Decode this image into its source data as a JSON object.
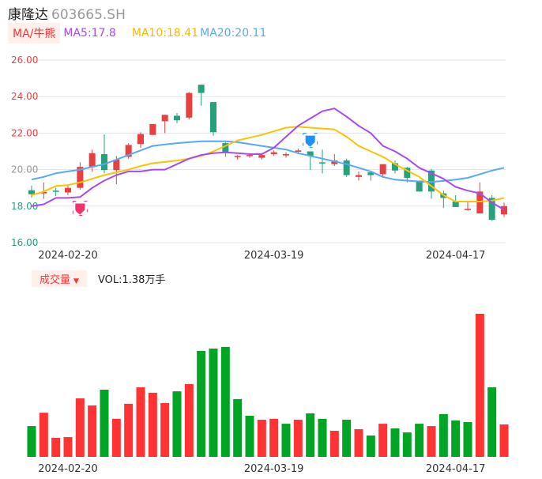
{
  "header": {
    "name": "康隆达",
    "code": "603665.SH"
  },
  "legend": {
    "tag": "MA/牛熊",
    "ma5": "MA5:17.8",
    "ma10": "MA10:18.41",
    "ma20": "MA20:20.11"
  },
  "volume_legend": {
    "tag": "成交量",
    "arrow": "▼",
    "value": "VOL:1.38万手"
  },
  "colors": {
    "up": "#e84040",
    "down": "#26a17d",
    "vol_up": "#ff3333",
    "vol_down": "#00a526",
    "ma5": "#a64bf4",
    "ma10": "#fbc400",
    "ma20": "#5aa7f5",
    "grid": "#e3e3ec",
    "axis_up": "#f23d3d",
    "axis_mid": "#999999",
    "axis_down": "#26a17d"
  },
  "chart_data": [
    {
      "type": "candlestick",
      "title": "",
      "ylim": [
        16,
        26
      ],
      "y_ticks": [
        "26.00",
        "24.00",
        "22.00",
        "20.00",
        "18.00",
        "16.00"
      ],
      "x_ticks": [
        {
          "index": 3,
          "label": "2024-02-20"
        },
        {
          "index": 20,
          "label": "2024-03-19"
        },
        {
          "index": 35,
          "label": "2024-04-17"
        }
      ],
      "grid": true,
      "ohlc": [
        [
          18.87,
          19.12,
          18.47,
          18.65
        ],
        [
          18.7,
          19.3,
          18.4,
          18.78
        ],
        [
          18.85,
          19.0,
          18.55,
          18.8
        ],
        [
          18.75,
          19.2,
          18.6,
          19.0
        ],
        [
          19.0,
          20.4,
          18.9,
          20.15
        ],
        [
          20.15,
          21.1,
          19.9,
          20.9
        ],
        [
          20.85,
          21.93,
          19.8,
          19.98
        ],
        [
          19.98,
          20.75,
          19.2,
          20.55
        ],
        [
          20.7,
          21.45,
          20.6,
          21.35
        ],
        [
          21.4,
          22.05,
          21.2,
          21.95
        ],
        [
          21.9,
          22.5,
          21.9,
          22.5
        ],
        [
          22.65,
          23.0,
          22.0,
          23.0
        ],
        [
          22.95,
          23.1,
          22.55,
          22.7
        ],
        [
          22.85,
          24.25,
          22.75,
          24.2
        ],
        [
          24.65,
          24.65,
          23.5,
          24.2
        ],
        [
          23.7,
          23.7,
          21.85,
          22.05
        ],
        [
          21.45,
          21.5,
          20.7,
          20.95
        ],
        [
          20.7,
          20.8,
          20.55,
          20.75
        ],
        [
          20.75,
          20.9,
          20.65,
          20.8
        ],
        [
          20.65,
          20.9,
          20.55,
          20.8
        ],
        [
          20.85,
          21.05,
          20.75,
          20.95
        ],
        [
          20.78,
          20.95,
          20.65,
          20.85
        ],
        [
          20.98,
          21.15,
          20.85,
          21.05
        ],
        [
          21.0,
          21.0,
          19.98,
          20.75
        ],
        [
          20.4,
          21.1,
          19.8,
          20.35
        ],
        [
          20.3,
          20.85,
          20.2,
          20.5
        ],
        [
          20.5,
          20.6,
          19.6,
          19.7
        ],
        [
          19.6,
          19.9,
          19.4,
          19.7
        ],
        [
          19.85,
          19.9,
          19.4,
          19.7
        ],
        [
          19.75,
          20.3,
          19.55,
          20.3
        ],
        [
          20.35,
          20.5,
          19.8,
          19.95
        ],
        [
          20.1,
          20.15,
          19.3,
          19.55
        ],
        [
          19.4,
          19.4,
          18.8,
          18.8
        ],
        [
          19.95,
          20.05,
          18.4,
          18.8
        ],
        [
          18.7,
          18.85,
          17.9,
          18.45
        ],
        [
          18.25,
          18.6,
          17.95,
          17.95
        ],
        [
          17.8,
          18.2,
          17.75,
          17.85
        ],
        [
          17.6,
          19.3,
          17.6,
          18.8
        ],
        [
          18.45,
          18.6,
          17.2,
          17.25
        ],
        [
          17.55,
          18.2,
          17.4,
          18.0
        ]
      ],
      "ma5": [
        18.0,
        18.1,
        18.45,
        18.45,
        18.5,
        19.0,
        19.4,
        19.7,
        19.9,
        19.9,
        20.0,
        20.0,
        20.3,
        20.6,
        20.8,
        20.9,
        20.95,
        20.9,
        20.85,
        20.85,
        21.2,
        21.8,
        22.4,
        22.8,
        23.2,
        23.35,
        22.9,
        22.4,
        22.0,
        21.3,
        21.0,
        20.6,
        20.1,
        19.8,
        19.5,
        19.05,
        18.85,
        18.7,
        18.2,
        17.8
      ],
      "ma10": [
        18.6,
        18.8,
        19.1,
        19.15,
        19.3,
        19.5,
        19.7,
        19.85,
        20.0,
        20.2,
        20.35,
        20.42,
        20.5,
        20.6,
        20.75,
        21.0,
        21.3,
        21.6,
        21.75,
        21.9,
        22.1,
        22.3,
        22.35,
        22.3,
        22.25,
        22.2,
        21.8,
        21.3,
        21.0,
        20.7,
        20.3,
        19.95,
        19.6,
        19.1,
        18.6,
        18.25,
        18.25,
        18.25,
        18.3,
        18.45
      ],
      "ma20": [
        19.46,
        19.6,
        19.8,
        19.9,
        20.0,
        20.15,
        20.3,
        20.55,
        20.8,
        21.05,
        21.3,
        21.38,
        21.45,
        21.5,
        21.55,
        21.56,
        21.55,
        21.5,
        21.4,
        21.3,
        21.2,
        21.1,
        20.9,
        20.75,
        20.6,
        20.45,
        20.3,
        20.1,
        19.9,
        19.6,
        19.45,
        19.4,
        19.35,
        19.33,
        19.38,
        19.45,
        19.55,
        19.75,
        19.95,
        20.1
      ],
      "markers": [
        {
          "index": 4,
          "type": "buy",
          "price": 18.4,
          "icon": "bull-signal-icon"
        },
        {
          "index": 23,
          "type": "sell",
          "price": 21.6,
          "icon": "bear-signal-icon"
        }
      ]
    },
    {
      "type": "bar",
      "title": "",
      "unit": "万手",
      "x_ticks": [
        {
          "index": 3,
          "label": "2024-02-20"
        },
        {
          "index": 20,
          "label": "2024-03-19"
        },
        {
          "index": 35,
          "label": "2024-04-17"
        }
      ],
      "values": [
        1.31,
        1.88,
        0.81,
        0.84,
        2.49,
        2.19,
        2.86,
        1.62,
        2.26,
        2.96,
        2.73,
        2.29,
        2.79,
        3.1,
        4.51,
        4.61,
        4.68,
        2.46,
        1.75,
        1.58,
        1.62,
        1.41,
        1.58,
        1.85,
        1.62,
        1.11,
        1.58,
        1.18,
        0.91,
        1.41,
        1.21,
        1.04,
        1.41,
        1.31,
        1.82,
        1.55,
        1.48,
        6.09,
        2.96,
        1.38
      ],
      "up": [
        0,
        1,
        1,
        1,
        1,
        1,
        0,
        1,
        1,
        1,
        1,
        1,
        0,
        1,
        0,
        0,
        0,
        0,
        0,
        1,
        1,
        0,
        1,
        0,
        0,
        1,
        0,
        1,
        0,
        1,
        0,
        0,
        0,
        1,
        0,
        0,
        0,
        1,
        0,
        1
      ]
    }
  ]
}
